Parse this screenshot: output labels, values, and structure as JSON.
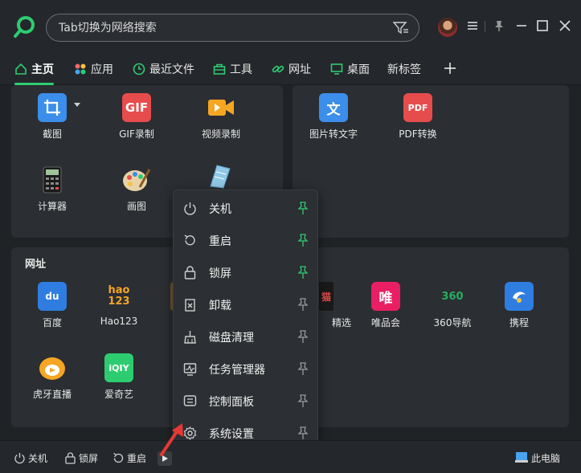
{
  "header": {
    "search_placeholder": "Tab切换为网络搜索",
    "icons": [
      "search-logo-icon",
      "filter-icon",
      "avatar",
      "menu-icon",
      "pin-icon",
      "minimize-icon",
      "maximize-icon",
      "close-icon"
    ]
  },
  "tabs": [
    {
      "label": "主页",
      "icon": "home-icon",
      "active": true
    },
    {
      "label": "应用",
      "icon": "apps-icon"
    },
    {
      "label": "最近文件",
      "icon": "clock-icon"
    },
    {
      "label": "工具",
      "icon": "toolbox-icon"
    },
    {
      "label": "网址",
      "icon": "link-icon"
    },
    {
      "label": "桌面",
      "icon": "monitor-icon"
    },
    {
      "label": "新标签",
      "icon": ""
    }
  ],
  "tools_left": [
    {
      "label": "截图",
      "icon": "crop-icon"
    },
    {
      "label": "GIF录制",
      "icon": "gif-icon",
      "badge": "GIF"
    },
    {
      "label": "视频录制",
      "icon": "video-icon"
    },
    {
      "label": "计算器",
      "icon": "calculator-icon"
    },
    {
      "label": "画图",
      "icon": "palette-icon"
    }
  ],
  "tools_right": [
    {
      "label": "图片转文字",
      "icon": "image-to-text-icon",
      "badge": "文"
    },
    {
      "label": "PDF转换",
      "icon": "pdf-icon",
      "badge": "PDF"
    }
  ],
  "websites": {
    "title": "网址",
    "items": [
      {
        "label": "百度",
        "icon": "baidu-icon",
        "badge": "du"
      },
      {
        "label": "Hao123",
        "icon": "hao123-icon",
        "badge": "hao 123"
      },
      {
        "label": "精选",
        "icon": "tmall-icon",
        "badge": "猫"
      },
      {
        "label": "唯品会",
        "icon": "vip-icon",
        "badge": "唯"
      },
      {
        "label": "360导航",
        "icon": "360-icon",
        "badge": "360"
      },
      {
        "label": "携程",
        "icon": "ctrip-icon"
      },
      {
        "label": "虎牙直播",
        "icon": "huya-icon"
      },
      {
        "label": "爱奇艺",
        "icon": "iqiyi-icon",
        "badge": "iQIY"
      }
    ]
  },
  "menu": [
    {
      "label": "关机",
      "icon": "power-icon",
      "pinned": true
    },
    {
      "label": "重启",
      "icon": "restart-icon",
      "pinned": true
    },
    {
      "label": "锁屏",
      "icon": "lock-icon",
      "pinned": true
    },
    {
      "label": "卸载",
      "icon": "uninstall-icon",
      "pinned": false
    },
    {
      "label": "磁盘清理",
      "icon": "broom-icon",
      "pinned": false
    },
    {
      "label": "任务管理器",
      "icon": "task-manager-icon",
      "pinned": false
    },
    {
      "label": "控制面板",
      "icon": "control-panel-icon",
      "pinned": false
    },
    {
      "label": "系统设置",
      "icon": "gear-icon",
      "pinned": false
    }
  ],
  "footer": {
    "shutdown": "关机",
    "lock": "锁屏",
    "restart": "重启",
    "this_pc": "此电脑"
  },
  "colors": {
    "accent": "#2ecc71",
    "background": "#24272b",
    "panel": "#2b2e32",
    "arrow": "#e53935"
  }
}
